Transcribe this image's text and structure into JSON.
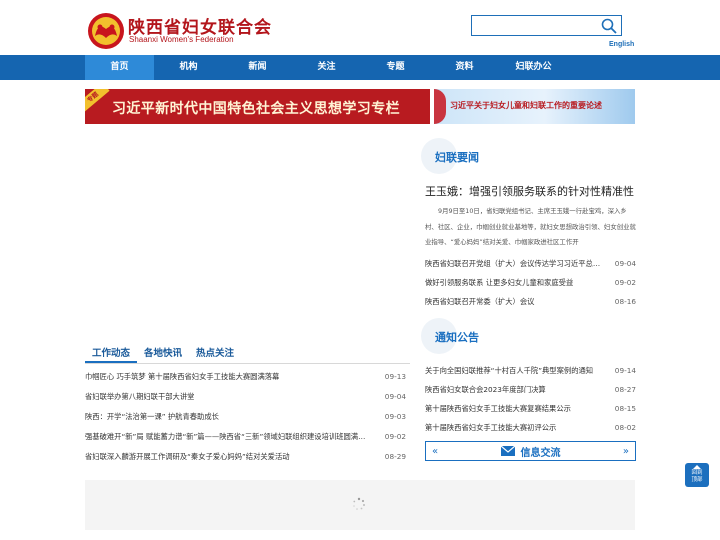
{
  "header": {
    "brand_cn": "陕西省妇女联合会",
    "brand_en": "Shaanxi Women's Federation",
    "search_placeholder": "",
    "english_link": "English"
  },
  "nav": {
    "items": [
      "首页",
      "机构",
      "新闻",
      "关注",
      "专题",
      "资料",
      "妇联办公"
    ],
    "active_index": 0
  },
  "banners": {
    "left_tag": "专题",
    "left_text": "习近平新时代中国特色社会主义思想学习专栏",
    "right_text": "习近平关于妇女儿童和妇联工作的重要论述"
  },
  "federation_news": {
    "title": "妇联要闻",
    "headline": "王玉娥：增强引领服务联系的针对性精准性",
    "summary": "9月9日至10日，省妇联党组书记、主席王玉娥一行赴宝鸡，深入乡村、社区、企业，巾帼创业就业基地等，就妇女思想政治引领、妇女创业就业指导、“爱心妈妈”结对关爱、巾帼家政进社区工作开",
    "items": [
      {
        "title": "陕西省妇联召开党组（扩大）会议传达学习习近平总书记",
        "date": "09-04"
      },
      {
        "title": "做好引领服务联系 让更多妇女儿童和家庭受益",
        "date": "09-02"
      },
      {
        "title": "陕西省妇联召开常委（扩大）会议",
        "date": "08-16"
      }
    ]
  },
  "notices": {
    "title": "通知公告",
    "items": [
      {
        "title": "关于向全国妇联推荐“十村百人千院”典型案例的通知",
        "date": "09-14"
      },
      {
        "title": "陕西省妇女联合会2023年度部门决算",
        "date": "08-27"
      },
      {
        "title": "第十届陕西省妇女手工技能大赛复赛结果公示",
        "date": "08-15"
      },
      {
        "title": "第十届陕西省妇女手工技能大赛初评公示",
        "date": "08-02"
      }
    ]
  },
  "info_exchange": {
    "label": "信息交流",
    "prev": "«",
    "next": "»"
  },
  "work_tabs": {
    "tabs": [
      "工作动态",
      "各地快讯",
      "热点关注"
    ],
    "active_index": 0,
    "items": [
      {
        "title": "巾帼匠心 巧手筑梦 第十届陕西省妇女手工技能大赛圆满落幕",
        "date": "09-13"
      },
      {
        "title": "省妇联举办第八期妇联干部大讲堂",
        "date": "09-04"
      },
      {
        "title": "陕西：开学“法治第一课” 护航青春助成长",
        "date": "09-03"
      },
      {
        "title": "强基破难开“新”局 赋能蓄力谱“新”篇——陕西省“三新”领域妇联组织建设培训班圆满结束",
        "date": "09-02"
      },
      {
        "title": "省妇联深入麟游开展工作调研及“秦女子爱心妈妈”结对关爱活动",
        "date": "08-29"
      }
    ]
  },
  "back_to_top": {
    "label_line1": "回到",
    "label_line2": "顶部"
  },
  "colors": {
    "brand_red": "#b3151b",
    "nav_blue": "#1565b0",
    "nav_active": "#2e8ad8",
    "link_blue": "#1a6fc0"
  }
}
